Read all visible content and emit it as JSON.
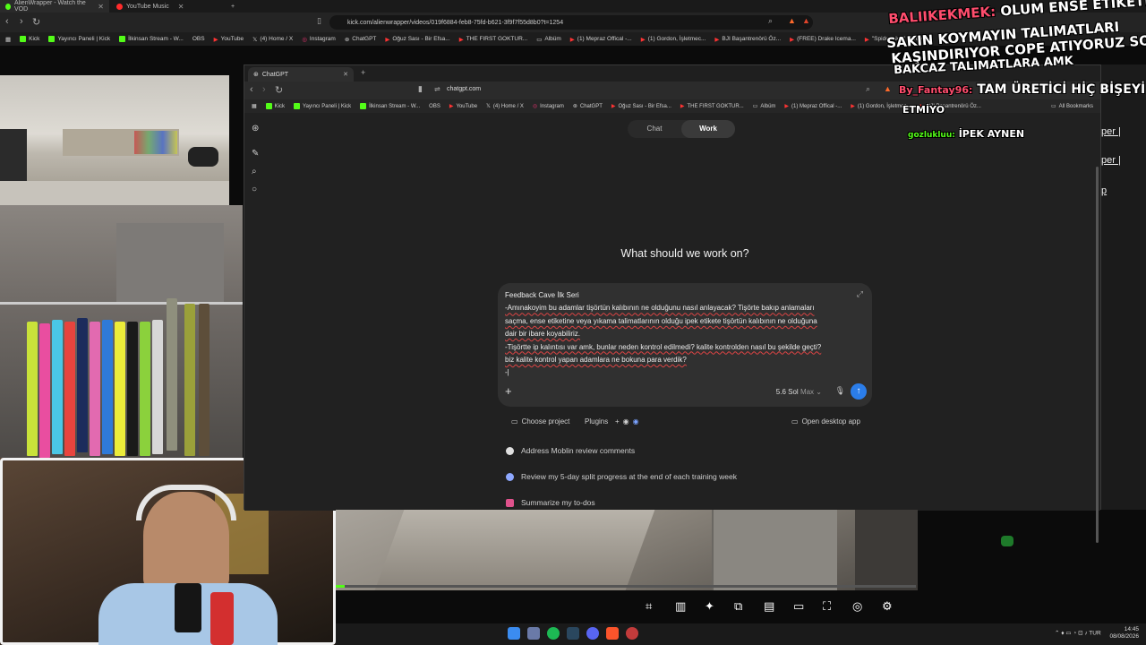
{
  "outer_browser": {
    "tabs": [
      {
        "label": "AlienWrapper - Watch the VOD",
        "active": true
      },
      {
        "label": "YouTube Music",
        "active": false
      }
    ],
    "url": "kick.com/alienwrapper/videos/019f6884-feb8-75fd-b621-3f9f7f55d8b0?t=1254",
    "bookmarks": [
      "Kick",
      "Yayıncı Paneli | Kick",
      "İlkinsan Stream - W...",
      "OBS",
      "YouTube",
      "(4) Home / X",
      "Instagram",
      "ChatGPT",
      "Oğuz Sası - Bir Efsa...",
      "THE FIRST GOKTUR...",
      "Albüm",
      "(1) Mepraz Offical -...",
      "(1) Gordon, İşletmec...",
      "BJI Başantrenörü Öz...",
      "(FREE) Drake Icema...",
      "\"Spider-Noir\" - True..."
    ]
  },
  "chatgpt_window": {
    "tab_title": "ChatGPT",
    "url": "chatgpt.com",
    "bookmarks": [
      "Kick",
      "Yayıncı Paneli | Kick",
      "İlkinsan Stream - W...",
      "OBS",
      "YouTube",
      "(4) Home / X",
      "Instagram",
      "ChatGPT",
      "Oğuz Sası - Bir Efsa...",
      "THE FIRST GOKTUR...",
      "Albüm",
      "(1) Mepraz Offical -...",
      "(1) Gordon, İşletmec...",
      "BJI Başantrenörü Öz...",
      "All Bookmarks"
    ],
    "mode_tabs": [
      "Chat",
      "Work"
    ],
    "active_mode": "Work",
    "headline": "What should we work on?",
    "composer_lines": [
      "Feedback Cave İlk Seri",
      "-Amınakoyim bu adamlar tişörtün kalıbının ne olduğunu nasıl anlayacak? Tişörte bakıp anlamaları",
      "saçma, ense etiketine veya yıkama talimatlarının olduğu ipek etikete tişörtün kalıbının ne olduğuna",
      "dair bir ibare koyabiliriz.",
      "-Tişörtte ip kalıntısı var amk, bunlar neden kontrol edilmedi? kalite kontrolden nasıl bu şekilde geçti?",
      "biz kalite kontrol yapan adamlara ne bokuna para verdik?",
      "-|"
    ],
    "model": "5.6 Sol",
    "model_tier": "Max",
    "choose_project": "Choose project",
    "plugins": "Plugins",
    "open_desktop": "Open desktop app",
    "suggestions": [
      {
        "label": "Address Moblin review comments",
        "icon": "github-icon",
        "color": "#e0e0e0"
      },
      {
        "label": "Review my 5-day split progress at the end of each training week",
        "icon": "calendar-icon",
        "color": "#8ea8ff"
      },
      {
        "label": "Summarize my to-dos",
        "icon": "slack-icon",
        "color": "#e0528c"
      }
    ]
  },
  "overlay_chat": [
    {
      "user": "BALIIKEKMEK:",
      "text": "OLUM ENSE ETİKETİ"
    },
    {
      "user": "",
      "text": "SAKIN KOYMAYIN TALIMATLARI"
    },
    {
      "user": "",
      "text": "KAŞINDIRIYOR COPE ATIYORUZ SONRA NA"
    },
    {
      "user": "",
      "text": "BAKCAZ TALIMATLARA AMK"
    },
    {
      "user": "By_Fantay96:",
      "text": "TAM ÜRETİCİ HİÇ BİŞEYİ KAB"
    },
    {
      "user": "",
      "text": "ETMİYO"
    },
    {
      "user": "gozlukluu:",
      "text": "İPEK AYNEN"
    }
  ],
  "right_links": [
    "per |",
    "per |",
    "p"
  ],
  "taskbar": {
    "lang": "TUR",
    "time": "14:45",
    "date": "08/08/2026"
  },
  "colors": {
    "kick_green": "#53fc18",
    "send_blue": "#2b7de9",
    "chatgpt_bg": "#212121",
    "composer_bg": "#303030"
  }
}
